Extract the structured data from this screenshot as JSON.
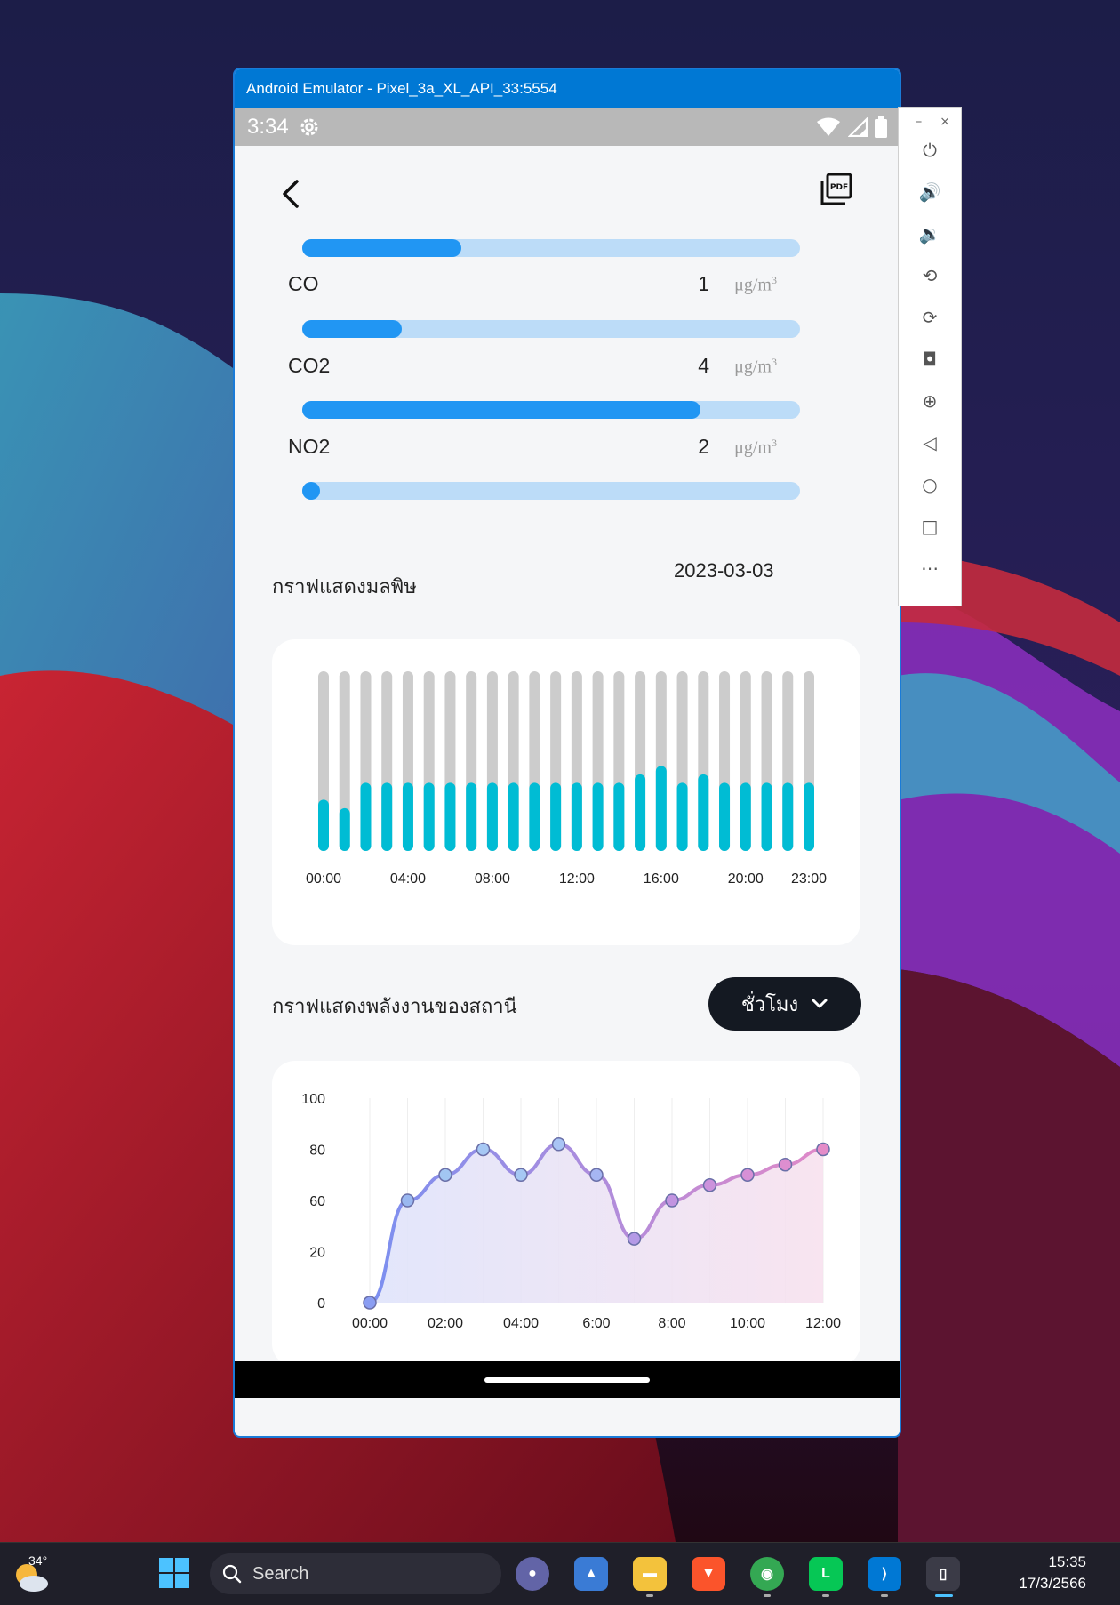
{
  "emulator": {
    "title": "Android Emulator - Pixel_3a_XL_API_33:5554"
  },
  "status_bar": {
    "time": "3:34"
  },
  "metrics": [
    {
      "label": "",
      "value": "",
      "unit": "",
      "progress": 0.32
    },
    {
      "label": "CO",
      "value": "1",
      "unit": "μg/m",
      "unit_sup": "3",
      "progress": 0.2
    },
    {
      "label": "CO2",
      "value": "4",
      "unit": "μg/m",
      "unit_sup": "3",
      "progress": 0.8
    },
    {
      "label": "NO2",
      "value": "2",
      "unit": "μg/m",
      "unit_sup": "3",
      "progress": 0.02
    }
  ],
  "pollution_section": {
    "title": "กราฟแสดงมลพิษ",
    "date": "2023-03-03"
  },
  "energy_section": {
    "title": "กราฟแสดงพลังงานของสถานี",
    "dropdown_label": "ชั่วโมง"
  },
  "chart_data": [
    {
      "type": "bar",
      "categories": [
        "00:00",
        "01:00",
        "02:00",
        "03:00",
        "04:00",
        "05:00",
        "06:00",
        "07:00",
        "08:00",
        "09:00",
        "10:00",
        "11:00",
        "12:00",
        "13:00",
        "14:00",
        "15:00",
        "16:00",
        "17:00",
        "18:00",
        "19:00",
        "20:00",
        "21:00",
        "22:00",
        "23:00"
      ],
      "tick_labels": [
        "00:00",
        "04:00",
        "08:00",
        "12:00",
        "16:00",
        "20:00",
        "23:00"
      ],
      "values": [
        24,
        19,
        34,
        34,
        34,
        34,
        34,
        34,
        34,
        34,
        34,
        34,
        34,
        34,
        34,
        39,
        44,
        34,
        39,
        34,
        34,
        34,
        34,
        34
      ],
      "ylim": [
        0,
        100
      ],
      "colors": {
        "fill": "#00bcd4",
        "background": "#cccccc"
      }
    },
    {
      "type": "area",
      "x": [
        "00:00",
        "01:00",
        "02:00",
        "03:00",
        "04:00",
        "05:00",
        "6:00",
        "7:00",
        "8:00",
        "9:00",
        "10:00",
        "11:00",
        "12:00"
      ],
      "tick_labels_x": [
        "00:00",
        "02:00",
        "04:00",
        "6:00",
        "8:00",
        "10:00",
        "12:00"
      ],
      "tick_labels_y": [
        "0",
        "20",
        "60",
        "80",
        "100"
      ],
      "y_ticks": [
        0,
        20,
        60,
        80,
        100
      ],
      "values": [
        0,
        60,
        70,
        80,
        70,
        82,
        70,
        30,
        60,
        66,
        70,
        74,
        80
      ],
      "colors": {
        "start": "#7b8ff0",
        "end": "#e089c8"
      }
    }
  ],
  "emulator_toolbar": {
    "items": [
      "power",
      "volume-up",
      "volume-down",
      "rotate-left",
      "rotate-right",
      "screenshot",
      "zoom",
      "back",
      "home",
      "overview",
      "more"
    ]
  },
  "taskbar": {
    "weather_temp": "34°",
    "search_placeholder": "Search",
    "clock_time": "15:35",
    "clock_date": "17/3/2566"
  }
}
